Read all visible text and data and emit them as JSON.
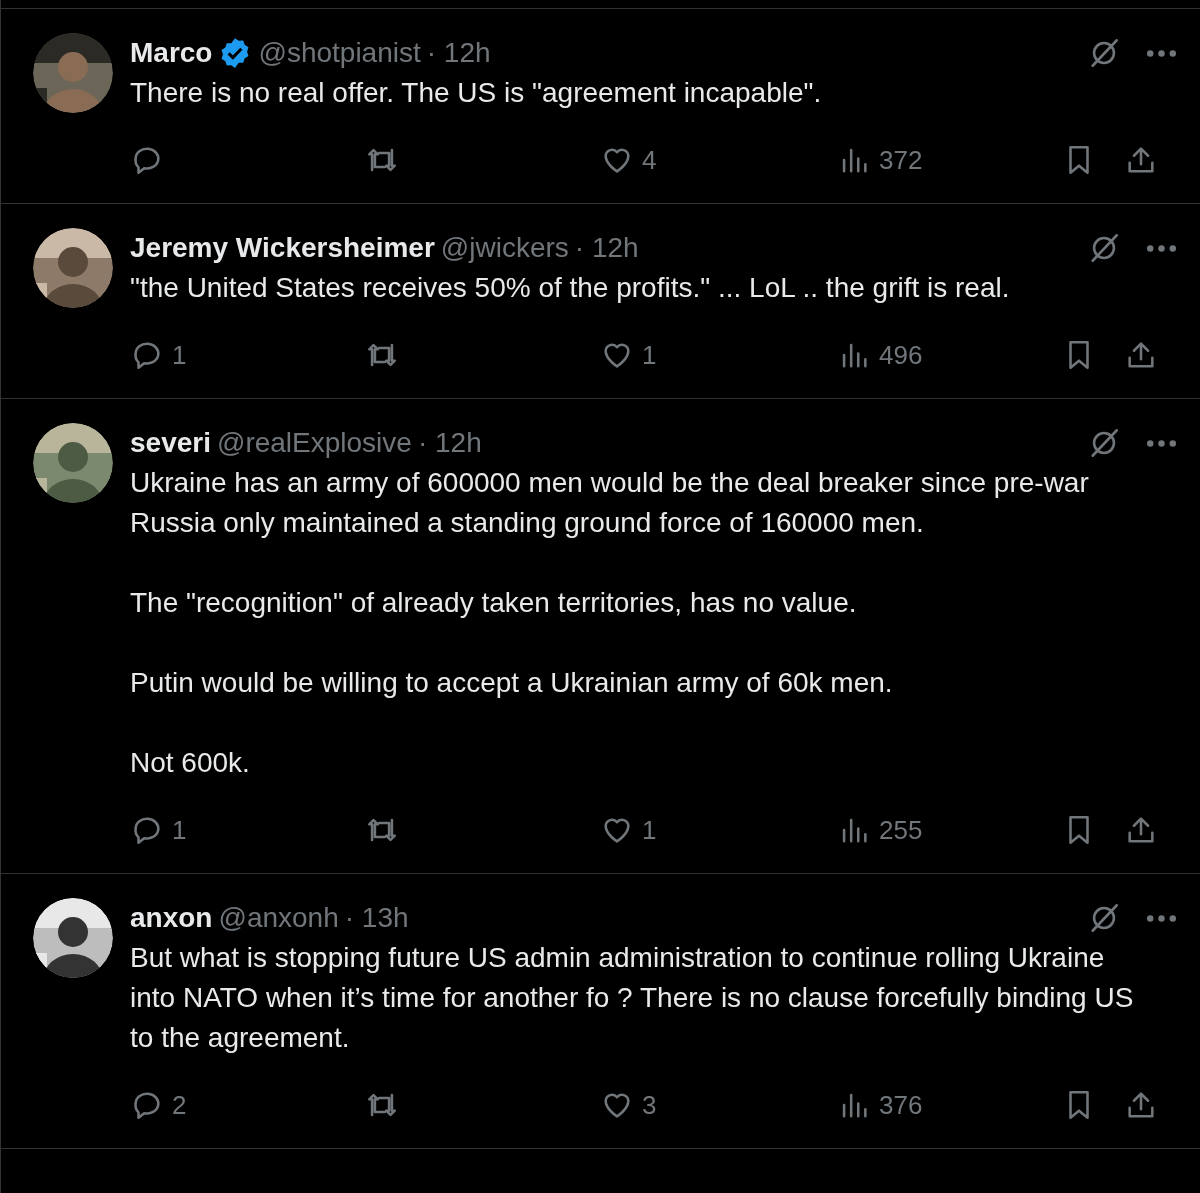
{
  "posts": [
    {
      "name": "Marco",
      "verified": true,
      "handle": "@shotpianist",
      "time": "· 12h",
      "paragraphs": [
        "There is no real offer. The US is \"agreement incapable\"."
      ],
      "likes": "4",
      "views": "372"
    },
    {
      "name": "Jeremy Wickersheimer",
      "verified": false,
      "handle": "@jwickers",
      "time": "· 12h",
      "paragraphs": [
        "\"the United States receives 50% of the profits.\" ... LoL .. the grift is real."
      ],
      "replies": "1",
      "likes": "1",
      "views": "496"
    },
    {
      "name": "severi",
      "verified": false,
      "handle": "@realExplosive",
      "time": "· 12h",
      "paragraphs": [
        "Ukraine has an army of 600000 men would be the deal breaker since pre-war Russia only maintained a standing ground force of 160000 men.",
        "The \"recognition\" of already taken territories, has no value.",
        "Putin would be willing to accept a Ukrainian army of 60k men.",
        "Not 600k."
      ],
      "replies": "1",
      "likes": "1",
      "views": "255"
    },
    {
      "name": "anxon",
      "verified": false,
      "handle": "@anxonh",
      "time": "· 13h",
      "paragraphs": [
        "But what is stopping future US admin administration to continue rolling Ukraine into NATO when it’s time for another fo ? There is no clause forcefully binding US to the agreement."
      ],
      "replies": "2",
      "likes": "3",
      "views": "376"
    }
  ]
}
